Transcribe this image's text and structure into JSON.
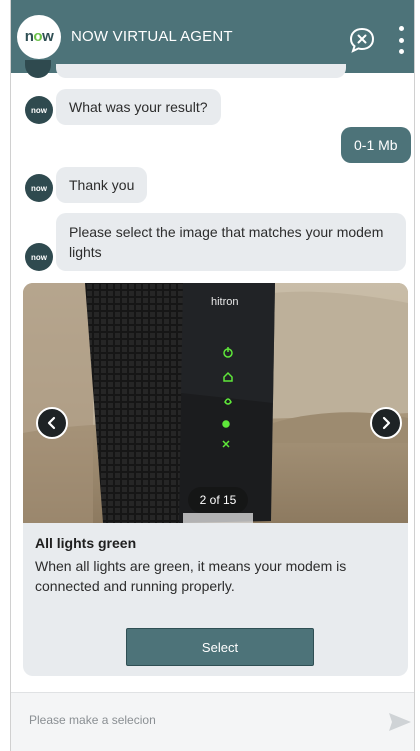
{
  "header": {
    "logo_text_a": "n",
    "logo_text_o": "o",
    "logo_text_w": "w",
    "title": "NOW VIRTUAL AGENT",
    "chat_icon": "chat-close-icon",
    "menu_icon": "vertical-dots-icon"
  },
  "avatar_label": "now",
  "messages": [
    {
      "from": "agent",
      "text": "What was your result?"
    },
    {
      "from": "user",
      "text": "0-1 Mb"
    },
    {
      "from": "agent",
      "text": "Thank you"
    },
    {
      "from": "agent",
      "text": "Please select the image that matches your modem lights"
    }
  ],
  "card": {
    "brand": "hitron",
    "counter": "2 of 15",
    "title": "All lights green",
    "description": "When all lights are green, it means your modem is connected and running properly.",
    "select_label": "Select",
    "prev_icon": "chevron-left-icon",
    "next_icon": "chevron-right-icon"
  },
  "composer": {
    "placeholder": "Please make a selecion",
    "send_icon": "send-icon"
  },
  "colors": {
    "header": "#4d7379",
    "bubble_agent": "#e8ebee",
    "bubble_user": "#4d7379",
    "logo_accent": "#6cc24a",
    "led_green": "#5fe83a"
  }
}
